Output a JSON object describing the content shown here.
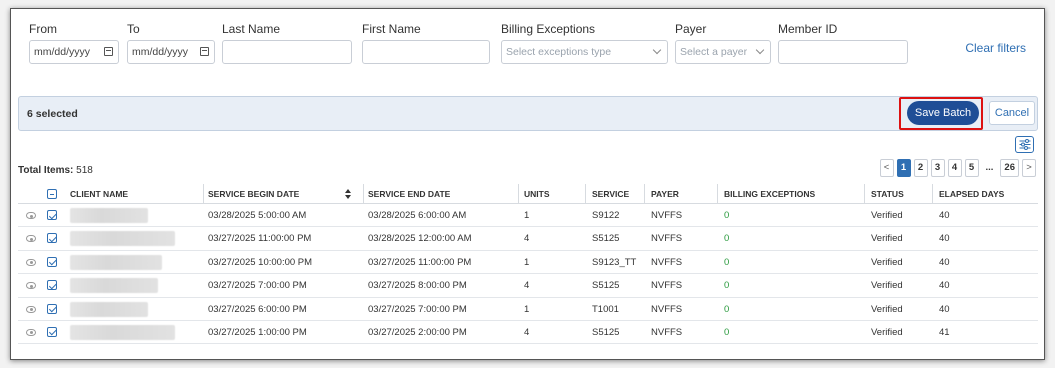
{
  "filters": {
    "from_label": "From",
    "from_placeholder": "mm/dd/yyyy",
    "to_label": "To",
    "to_placeholder": "mm/dd/yyyy",
    "last_name_label": "Last Name",
    "first_name_label": "First Name",
    "billing_exceptions_label": "Billing Exceptions",
    "billing_exceptions_placeholder": "Select exceptions type",
    "payer_label": "Payer",
    "payer_placeholder": "Select a payer",
    "member_id_label": "Member ID",
    "clear_filters": "Clear filters"
  },
  "batch": {
    "selected_text": "6 selected",
    "save_label": "Save Batch",
    "cancel_label": "Cancel"
  },
  "colors": {
    "primary": "#1f4e96",
    "link": "#2f6fb3",
    "highlight": "#d11111",
    "positive": "#2a9a3e"
  },
  "summary": {
    "total_label": "Total Items:",
    "total_value": "518"
  },
  "pagination": {
    "prev": "<",
    "pages": [
      "1",
      "2",
      "3",
      "4",
      "5"
    ],
    "ellipsis": "...",
    "last": "26",
    "next": ">",
    "current": "1"
  },
  "table": {
    "columns": {
      "client_name": "CLIENT NAME",
      "service_begin": "SERVICE BEGIN DATE",
      "service_end": "SERVICE END DATE",
      "units": "UNITS",
      "service": "SERVICE",
      "payer": "PAYER",
      "billing_exceptions": "BILLING EXCEPTIONS",
      "status": "STATUS",
      "elapsed_days": "ELAPSED DAYS"
    },
    "rows": [
      {
        "begin": "03/28/2025 5:00:00 AM",
        "end": "03/28/2025 6:00:00 AM",
        "units": "1",
        "service": "S9122",
        "payer": "NVFFS",
        "exceptions": "0",
        "status": "Verified",
        "elapsed": "40",
        "checked": true
      },
      {
        "begin": "03/27/2025 11:00:00 PM",
        "end": "03/28/2025 12:00:00 AM",
        "units": "4",
        "service": "S5125",
        "payer": "NVFFS",
        "exceptions": "0",
        "status": "Verified",
        "elapsed": "40",
        "checked": true
      },
      {
        "begin": "03/27/2025 10:00:00 PM",
        "end": "03/27/2025 11:00:00 PM",
        "units": "1",
        "service": "S9123_TT",
        "payer": "NVFFS",
        "exceptions": "0",
        "status": "Verified",
        "elapsed": "40",
        "checked": true
      },
      {
        "begin": "03/27/2025 7:00:00 PM",
        "end": "03/27/2025 8:00:00 PM",
        "units": "4",
        "service": "S5125",
        "payer": "NVFFS",
        "exceptions": "0",
        "status": "Verified",
        "elapsed": "40",
        "checked": true
      },
      {
        "begin": "03/27/2025 6:00:00 PM",
        "end": "03/27/2025 7:00:00 PM",
        "units": "1",
        "service": "T1001",
        "payer": "NVFFS",
        "exceptions": "0",
        "status": "Verified",
        "elapsed": "40",
        "checked": true
      },
      {
        "begin": "03/27/2025 1:00:00 PM",
        "end": "03/27/2025 2:00:00 PM",
        "units": "4",
        "service": "S5125",
        "payer": "NVFFS",
        "exceptions": "0",
        "status": "Verified",
        "elapsed": "41",
        "checked": true
      }
    ]
  }
}
